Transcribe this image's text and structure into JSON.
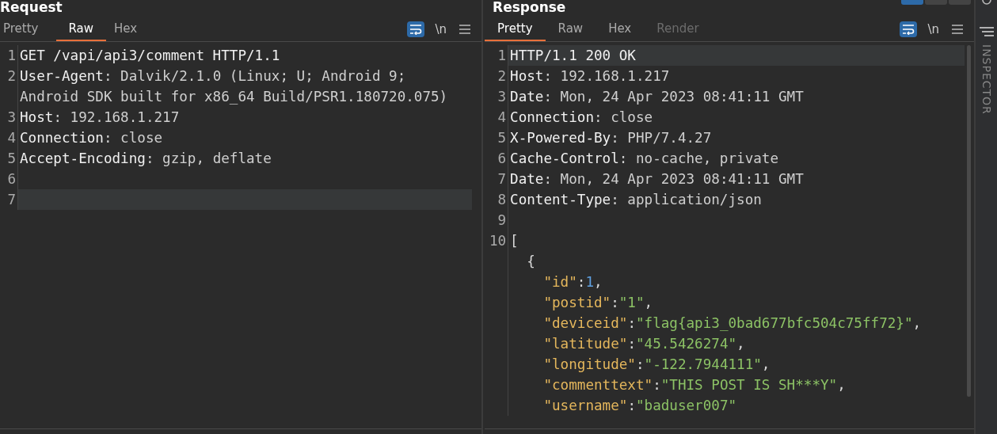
{
  "panels": [
    {
      "title": "Request",
      "tabs": [
        {
          "label": "Pretty",
          "selected": false,
          "disabled": false
        },
        {
          "label": "Raw",
          "selected": true,
          "disabled": false
        },
        {
          "label": "Hex",
          "selected": false,
          "disabled": false
        }
      ],
      "toolbar": {
        "wrap_on": true,
        "newline_label": "\\n"
      },
      "lines": [
        {
          "number": "1",
          "current": false,
          "segments": [
            {
              "kind": "name",
              "text": "GET /vapi/api3/comment HTTP/1.1"
            }
          ]
        },
        {
          "number": "2",
          "current": false,
          "segments": [
            {
              "kind": "name",
              "text": "User-Agent"
            },
            {
              "kind": "value",
              "text": ": Dalvik/2.1.0 (Linux; U; Android 9; Android SDK built for x86_64 Build/PSR1.180720.075)"
            }
          ]
        },
        {
          "number": "3",
          "current": false,
          "segments": [
            {
              "kind": "name",
              "text": "Host"
            },
            {
              "kind": "value",
              "text": ": 192.168.1.217"
            }
          ]
        },
        {
          "number": "4",
          "current": false,
          "segments": [
            {
              "kind": "name",
              "text": "Connection"
            },
            {
              "kind": "value",
              "text": ": close"
            }
          ]
        },
        {
          "number": "5",
          "current": false,
          "segments": [
            {
              "kind": "name",
              "text": "Accept-Encoding"
            },
            {
              "kind": "value",
              "text": ": gzip, deflate"
            }
          ]
        },
        {
          "number": "6",
          "current": false
        },
        {
          "number": "7",
          "current": true
        }
      ]
    },
    {
      "title": "Response",
      "tabs": [
        {
          "label": "Pretty",
          "selected": true,
          "disabled": false
        },
        {
          "label": "Raw",
          "selected": false,
          "disabled": false
        },
        {
          "label": "Hex",
          "selected": false,
          "disabled": false
        },
        {
          "label": "Render",
          "selected": false,
          "disabled": true
        }
      ],
      "toolbar": {
        "wrap_on": true,
        "newline_label": "\\n"
      },
      "lines": [
        {
          "number": "1",
          "current": true,
          "segments": [
            {
              "kind": "name",
              "text": "HTTP/1.1 200 OK"
            }
          ]
        },
        {
          "number": "2",
          "current": false,
          "segments": [
            {
              "kind": "name",
              "text": "Host"
            },
            {
              "kind": "value",
              "text": ": 192.168.1.217"
            }
          ]
        },
        {
          "number": "3",
          "current": false,
          "segments": [
            {
              "kind": "name",
              "text": "Date"
            },
            {
              "kind": "value",
              "text": ": Mon, 24 Apr 2023 08:41:11 GMT"
            }
          ]
        },
        {
          "number": "4",
          "current": false,
          "segments": [
            {
              "kind": "name",
              "text": "Connection"
            },
            {
              "kind": "value",
              "text": ": close"
            }
          ]
        },
        {
          "number": "5",
          "current": false,
          "segments": [
            {
              "kind": "name",
              "text": "X-Powered-By"
            },
            {
              "kind": "value",
              "text": ": PHP/7.4.27"
            }
          ]
        },
        {
          "number": "6",
          "current": false,
          "segments": [
            {
              "kind": "name",
              "text": "Cache-Control"
            },
            {
              "kind": "value",
              "text": ": no-cache, private"
            }
          ]
        },
        {
          "number": "7",
          "current": false,
          "segments": [
            {
              "kind": "name",
              "text": "Date"
            },
            {
              "kind": "value",
              "text": ": Mon, 24 Apr 2023 08:41:11 GMT"
            }
          ]
        },
        {
          "number": "8",
          "current": false,
          "segments": [
            {
              "kind": "name",
              "text": "Content-Type"
            },
            {
              "kind": "value",
              "text": ": application/json"
            }
          ]
        },
        {
          "number": "9",
          "current": false
        },
        {
          "number": "10",
          "current": false,
          "segments": [
            {
              "kind": "punct",
              "text": "["
            }
          ]
        },
        {
          "current": false,
          "segments": [
            {
              "kind": "punct",
              "text": "  {"
            }
          ]
        },
        {
          "current": false,
          "segments": [
            {
              "kind": "key",
              "text": "    \"id\""
            },
            {
              "kind": "punct",
              "text": ":"
            },
            {
              "kind": "number",
              "text": "1"
            },
            {
              "kind": "punct",
              "text": ","
            }
          ]
        },
        {
          "current": false,
          "segments": [
            {
              "kind": "key",
              "text": "    \"postid\""
            },
            {
              "kind": "punct",
              "text": ":"
            },
            {
              "kind": "string",
              "text": "\"1\""
            },
            {
              "kind": "punct",
              "text": ","
            }
          ]
        },
        {
          "current": false,
          "segments": [
            {
              "kind": "key",
              "text": "    \"deviceid\""
            },
            {
              "kind": "punct",
              "text": ":"
            },
            {
              "kind": "string",
              "text": "\"flag{api3_0bad677bfc504c75ff72}\""
            },
            {
              "kind": "punct",
              "text": ","
            }
          ]
        },
        {
          "current": false,
          "segments": [
            {
              "kind": "key",
              "text": "    \"latitude\""
            },
            {
              "kind": "punct",
              "text": ":"
            },
            {
              "kind": "string",
              "text": "\"45.5426274\""
            },
            {
              "kind": "punct",
              "text": ","
            }
          ]
        },
        {
          "current": false,
          "segments": [
            {
              "kind": "key",
              "text": "    \"longitude\""
            },
            {
              "kind": "punct",
              "text": ":"
            },
            {
              "kind": "string",
              "text": "\"-122.7944111\""
            },
            {
              "kind": "punct",
              "text": ","
            }
          ]
        },
        {
          "current": false,
          "segments": [
            {
              "kind": "key",
              "text": "    \"commenttext\""
            },
            {
              "kind": "punct",
              "text": ":"
            },
            {
              "kind": "string",
              "text": "\"THIS POST IS SH***Y\""
            },
            {
              "kind": "punct",
              "text": ","
            }
          ]
        },
        {
          "current": false,
          "segments": [
            {
              "kind": "key",
              "text": "    \"username\""
            },
            {
              "kind": "punct",
              "text": ":"
            },
            {
              "kind": "string",
              "text": "\"baduser007\""
            }
          ]
        }
      ]
    }
  ],
  "layout_toggles": [
    {
      "selected": true
    },
    {
      "selected": false
    },
    {
      "selected": false
    }
  ],
  "sidebar": {
    "label": "INSPECTOR"
  }
}
